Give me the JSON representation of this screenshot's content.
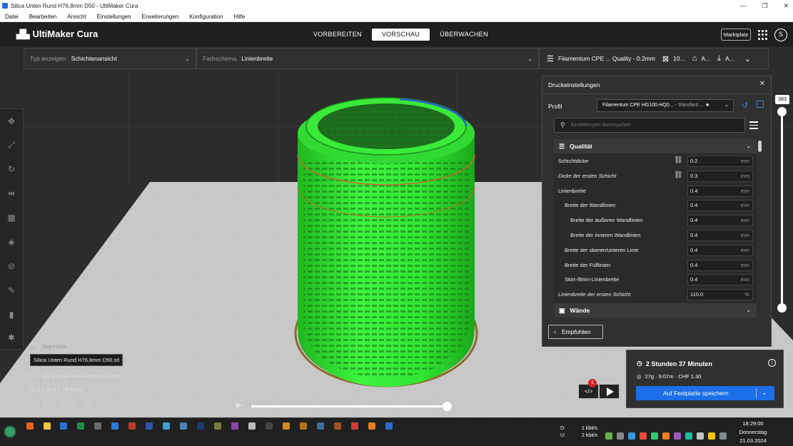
{
  "window": {
    "title": "Silica Unten Rund H76.8mm D50 - UltiMaker Cura",
    "controls": [
      "—",
      "❐",
      "✕"
    ]
  },
  "menu": [
    "Datei",
    "Bearbeiten",
    "Ansicht",
    "Einstellungen",
    "Erweiterungen",
    "Konfiguration",
    "Hilfe"
  ],
  "header": {
    "logo": "UltiMaker Cura",
    "stages": [
      "VORBEREITEN",
      "VORSCHAU",
      "ÜBERWACHEN"
    ],
    "active_stage": "VORSCHAU",
    "marketplace": "Marktplatz",
    "avatar_initial": "S"
  },
  "toolbar": {
    "view_type_label": "Typ anzeigen",
    "view_type_value": "Schichtenansicht",
    "color_scheme_label": "Farbschema",
    "color_scheme_value": "Linienbreite",
    "print_profile": "Filamentum CPE ... Quality - 0.2mm",
    "infill": "10...",
    "support": "A...",
    "adhesion": "A..."
  },
  "print_settings": {
    "title": "Druckeinstellungen",
    "profile_label": "Profil",
    "profile_value": "Filamentum CPE HG100-HQ0...",
    "profile_suffix": "- Standard ...",
    "search_placeholder": "Einstellungen durchsuchen",
    "categories": [
      {
        "name": "Qualität",
        "icon": "quality-icon"
      },
      {
        "name": "Wände",
        "icon": "walls-icon"
      }
    ],
    "settings": [
      {
        "name": "Schichtdicke",
        "value": "0.2",
        "unit": "mm",
        "link": true,
        "indent": 0,
        "italic": false
      },
      {
        "name": "Dicke der ersten Schicht",
        "value": "0.3",
        "unit": "mm",
        "link": true,
        "indent": 0,
        "italic": true
      },
      {
        "name": "Linienbreite",
        "value": "0.4",
        "unit": "mm",
        "link": false,
        "indent": 0,
        "italic": false
      },
      {
        "name": "Breite der Wandlinien",
        "value": "0.4",
        "unit": "mm",
        "link": false,
        "indent": 1,
        "italic": false
      },
      {
        "name": "Breite der äußeren Wandlinien",
        "value": "0.4",
        "unit": "mm",
        "link": false,
        "indent": 2,
        "italic": false
      },
      {
        "name": "Breite der inneren Wandlinien",
        "value": "0.4",
        "unit": "mm",
        "link": false,
        "indent": 2,
        "italic": false
      },
      {
        "name": "Breite der oberen/unteren Linie",
        "value": "0.4",
        "unit": "mm",
        "link": false,
        "indent": 1,
        "italic": false
      },
      {
        "name": "Breite der Fülllinien",
        "value": "0.4",
        "unit": "mm",
        "link": false,
        "indent": 1,
        "italic": false
      },
      {
        "name": "Skirt-/Brim-Linienbreite",
        "value": "0.4",
        "unit": "mm",
        "link": false,
        "indent": 1,
        "italic": false
      },
      {
        "name": "Linienbreite der ersten Schicht",
        "value": "110.0",
        "unit": "%",
        "link": false,
        "indent": 0,
        "italic": true
      }
    ],
    "recommended_button": "Empfohlen"
  },
  "layer_slider": {
    "value": "383"
  },
  "object_list": {
    "header": "Objektliste",
    "tooltip": "Silica Unten Rund H76.8mm D50.stl",
    "item": "Silica Unten Rund H76.8mm D50",
    "dimensions": "50.1 x 50.1 x 76.8 mm"
  },
  "output": {
    "time": "2 Stunden 37 Minuten",
    "material": "27g · 9.07m · CHF 1.30",
    "save_button": "Auf Festplatte speichern",
    "notification_count": "1",
    "code_label": "</>"
  },
  "taskbar": {
    "net_down_label": "D:",
    "net_down": "1 kbit/s",
    "net_up_label": "U:",
    "net_up": "2 kbit/s",
    "time": "18:29:00",
    "day": "Donnerstag",
    "date": "21.03.2024"
  }
}
